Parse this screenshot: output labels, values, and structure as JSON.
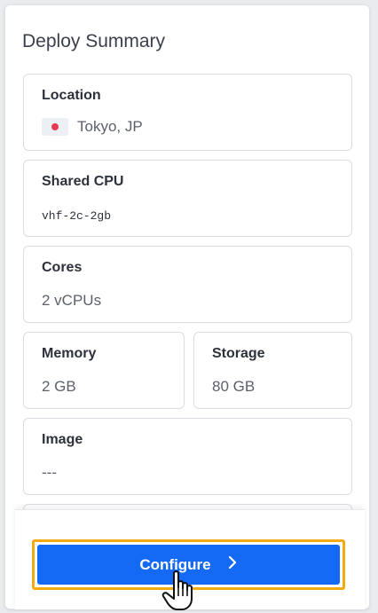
{
  "panel": {
    "title": "Deploy Summary"
  },
  "location": {
    "label": "Location",
    "value": "Tokyo, JP",
    "flag": "japan-flag-icon"
  },
  "shared_cpu": {
    "label": "Shared CPU",
    "value": "vhf-2c-2gb"
  },
  "cores": {
    "label": "Cores",
    "value": "2 vCPUs"
  },
  "memory": {
    "label": "Memory",
    "value": "2 GB"
  },
  "storage": {
    "label": "Storage",
    "value": "80 GB"
  },
  "image": {
    "label": "Image",
    "value": "---"
  },
  "footer": {
    "configure_label": "Configure",
    "configure_icon": "chevron-right-icon"
  },
  "colors": {
    "accent": "#1469f5",
    "highlight_border": "#f2ab12",
    "flag_red": "#e23b53"
  },
  "cursor": "hand-pointer-icon"
}
